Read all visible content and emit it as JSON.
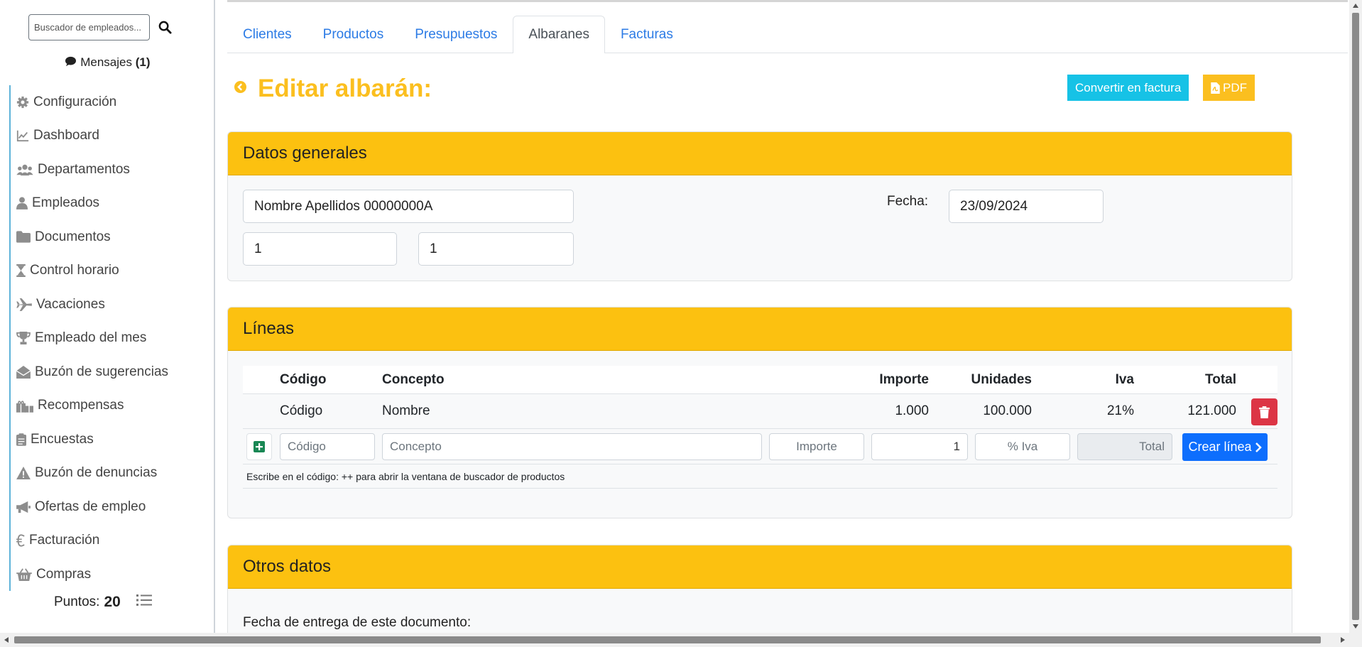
{
  "sidebar": {
    "search_placeholder": "Buscador de empleados...",
    "messages_label": "Mensajes",
    "messages_count": "(1)",
    "items": [
      {
        "label": "Configuración",
        "icon": "gear-icon"
      },
      {
        "label": "Dashboard",
        "icon": "chart-line-icon"
      },
      {
        "label": "Departamentos",
        "icon": "users-icon"
      },
      {
        "label": "Empleados",
        "icon": "user-icon"
      },
      {
        "label": "Documentos",
        "icon": "folder-icon"
      },
      {
        "label": "Control horario",
        "icon": "hourglass-icon"
      },
      {
        "label": "Vacaciones",
        "icon": "plane-icon"
      },
      {
        "label": "Empleado del mes",
        "icon": "trophy-icon"
      },
      {
        "label": "Buzón de sugerencias",
        "icon": "envelope-open-icon"
      },
      {
        "label": "Recompensas",
        "icon": "gifts-icon"
      },
      {
        "label": "Encuestas",
        "icon": "clipboard-icon"
      },
      {
        "label": "Buzón de denuncias",
        "icon": "warning-icon"
      },
      {
        "label": "Ofertas de empleo",
        "icon": "megaphone-icon"
      },
      {
        "label": "Facturación",
        "icon": "euro-icon"
      },
      {
        "label": "Compras",
        "icon": "basket-icon"
      }
    ],
    "points_label": "Puntos:",
    "points_value": "20"
  },
  "tabs": [
    {
      "label": "Clientes",
      "active": false
    },
    {
      "label": "Productos",
      "active": false
    },
    {
      "label": "Presupuestos",
      "active": false
    },
    {
      "label": "Albaranes",
      "active": true
    },
    {
      "label": "Facturas",
      "active": false
    }
  ],
  "page": {
    "title": "Editar albarán:",
    "convert_button": "Convertir en factura",
    "pdf_button": "PDF"
  },
  "general": {
    "header": "Datos generales",
    "client": "Nombre Apellidos 00000000A",
    "field_a": "1",
    "field_b": "1",
    "date_label": "Fecha:",
    "date": "23/09/2024"
  },
  "lines": {
    "header": "Líneas",
    "columns": {
      "codigo": "Código",
      "concepto": "Concepto",
      "importe": "Importe",
      "unidades": "Unidades",
      "iva": "Iva",
      "total": "Total"
    },
    "rows": [
      {
        "codigo": "Código",
        "concepto": "Nombre",
        "importe": "1.000",
        "unidades": "100.000",
        "iva": "21%",
        "total": "121.000"
      }
    ],
    "new_line": {
      "codigo_placeholder": "Código",
      "concepto_placeholder": "Concepto",
      "importe_placeholder": "Importe",
      "unidades_value": "1",
      "iva_placeholder": "% Iva",
      "total_placeholder": "Total",
      "create_button": "Crear línea"
    },
    "help": "Escribe en el código: ++ para abrir la ventana de buscador de productos"
  },
  "other": {
    "header": "Otros datos",
    "delivery_label": "Fecha de entrega de este documento:"
  },
  "colors": {
    "accent_yellow": "#fcc110",
    "title_yellow": "#fbbf1f",
    "info": "#16c2e6",
    "primary": "#0d6efd",
    "danger": "#dc3545",
    "link": "#2c7be5"
  }
}
